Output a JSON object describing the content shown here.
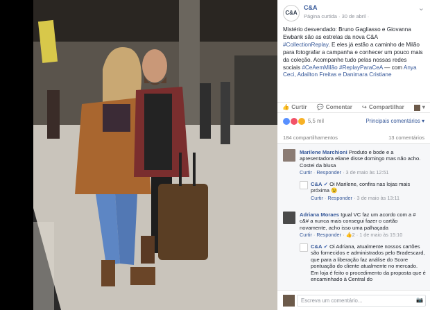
{
  "post": {
    "page_name": "C&A",
    "logo_text": "C&A",
    "meta": "Página curtida · 30 de abril ·",
    "text": "Mistério desvendado: Bruno Gagliasso e Giovanna Ewbank são as estrelas da nova C&A ",
    "tags": [
      "#CollectionReplay",
      "#CeAemMilão",
      "#ReplayParaCeA"
    ],
    "text_2": ". E eles já estão a caminho de Milão para fotografar a campanha e conhecer um pouco mais da coleção. Acompanhe tudo pelas nossas redes sociais ",
    "text_3": " — com ",
    "with_names": "Anya Ceci, Adailton Freitas e Danimara Cristiane"
  },
  "actions": {
    "like": "Curtir",
    "comment": "Comentar",
    "share": "Compartilhar"
  },
  "reactions": {
    "count": "5,5 mil",
    "sort": "Principais comentários ▾",
    "colors": [
      "#5890ff",
      "#f25268",
      "#f7b125"
    ]
  },
  "stats": {
    "shares": "184 compartilhamentos",
    "comments": "13 comentários"
  },
  "comments": [
    {
      "name": "Marilene Marchioni",
      "text": "Produto e bode e a apresentadora eliane disse domingo mas não acho. Costei da blusa",
      "like": "Curtir",
      "reply": "Responder",
      "time": "3 de maio às 12:51"
    },
    {
      "name": "C&A",
      "text": "Oi Marilene, confira nas lojas mais próxima 😉",
      "like": "Curtir",
      "reply": "Responder",
      "time": "3 de maio às 13:11"
    },
    {
      "name": "Adriana Moraes",
      "text": "Igual VC faz um acordo com a # c&# a nunca mais consegui fazer o cartão novamente, acho isso uma palhaçada",
      "like": "Curtir",
      "reply": "Responder",
      "count": "2",
      "time": "1 de maio às 15:10"
    },
    {
      "name": "C&A",
      "text": "Oi Adriana, atualmente nossos cartões são fornecidos e administrados pelo Bradescard, que para a liberação faz análise do Score pontuação do cliente atualmente no mercado. Em loja é feito o procedimento da proposta que é encaminhado à Central do"
    }
  ],
  "write_placeholder": "Escreva um comentário..."
}
